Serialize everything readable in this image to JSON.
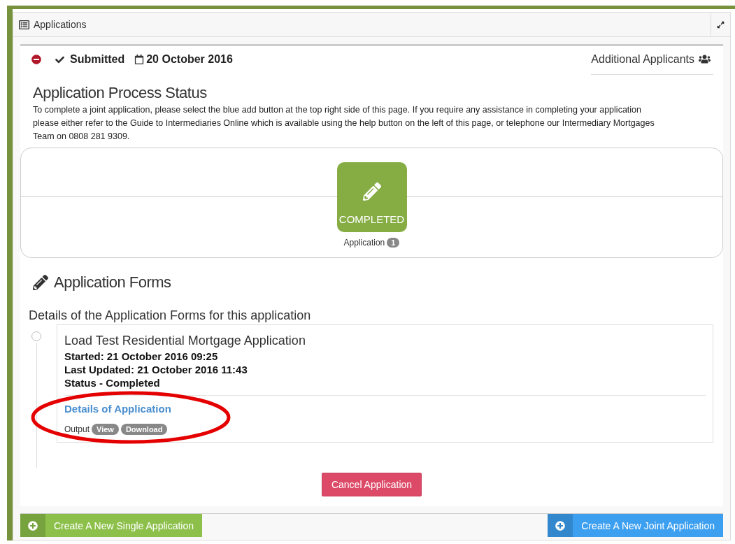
{
  "panel": {
    "title": "Applications"
  },
  "summary": {
    "status": "Submitted",
    "date": "20 October 2016",
    "additional_applicants": "Additional Applicants"
  },
  "process": {
    "title": "Application Process Status",
    "description": "To complete a joint application, please select the blue add button at the top right side of this page. If you require any assistance in completing your application please either refer to the Guide to Intermediaries Online which is available using the help button on the left of this page, or telephone our Intermediary Mortgages Team on 0808 281 9309.",
    "steps": [
      {
        "kind": "completed",
        "status": "COMPLETED",
        "label": "Application",
        "count": "1"
      }
    ]
  },
  "forms": {
    "title": "Application Forms",
    "subtitle": "Details of the Application Forms for this application",
    "items": [
      {
        "title": "Load Test Residential Mortgage Application",
        "started": "Started: 21 October 2016 09:25",
        "updated": "Last Updated: 21 October 2016 11:43",
        "status": "Status - Completed",
        "link": "Details of Application",
        "output_label": "Output",
        "outputs": [
          "View",
          "Download"
        ]
      }
    ]
  },
  "annotation": {
    "kind": "ellipse",
    "color": "#e50000"
  },
  "cancel_button": "Cancel Application",
  "footer": {
    "buttons": [
      {
        "label": "Create A New Single Application",
        "color": "#8cc04a"
      },
      {
        "label": "Create A New Joint Application",
        "color": "#3d9ff0"
      }
    ]
  }
}
